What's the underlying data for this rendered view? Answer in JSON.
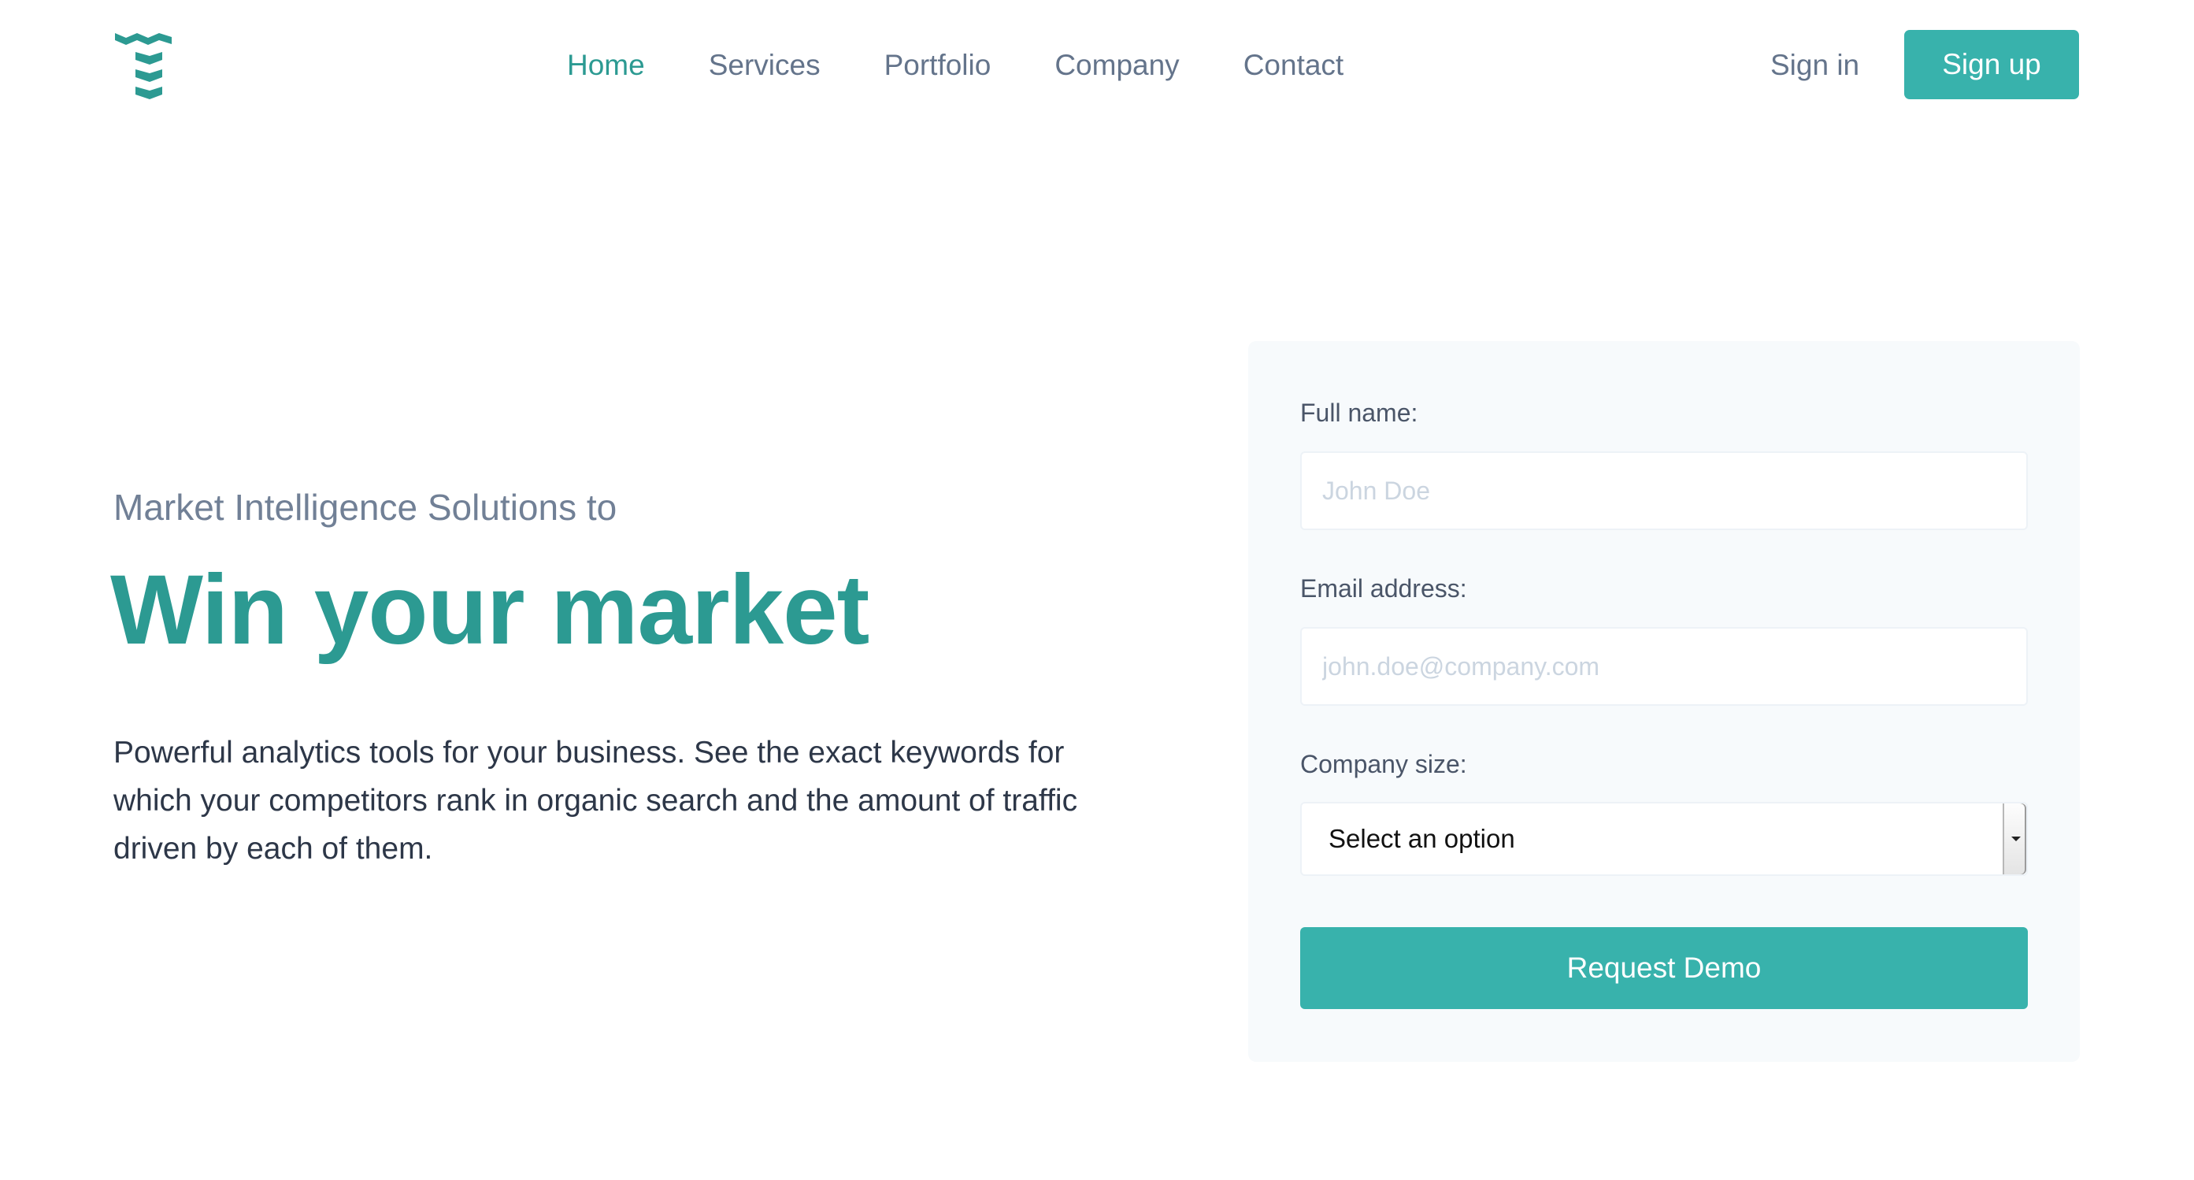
{
  "header": {
    "logo": {
      "icon": "logo-icon",
      "color": "#2c9a92"
    },
    "nav": [
      {
        "label": "Home",
        "active": true
      },
      {
        "label": "Services",
        "active": false
      },
      {
        "label": "Portfolio",
        "active": false
      },
      {
        "label": "Company",
        "active": false
      },
      {
        "label": "Contact",
        "active": false
      }
    ],
    "sign_in": "Sign in",
    "sign_up": "Sign up"
  },
  "hero": {
    "subtitle": "Market Intelligence Solutions to",
    "title": "Win your market",
    "description": "Powerful analytics tools for your business. See the exact keywords for which your competitors rank in organic search and the amount of traffic driven by each of them."
  },
  "form": {
    "full_name_label": "Full name:",
    "full_name_placeholder": "John Doe",
    "full_name_value": "",
    "email_label": "Email address:",
    "email_placeholder": "john.doe@company.com",
    "email_value": "",
    "company_size_label": "Company size:",
    "company_size_selected": "Select an option",
    "submit_label": "Request Demo"
  },
  "colors": {
    "accent": "#38b2ac",
    "accent_dark": "#2c9a92",
    "text_muted": "#718096",
    "card_bg": "#f7fafc"
  }
}
